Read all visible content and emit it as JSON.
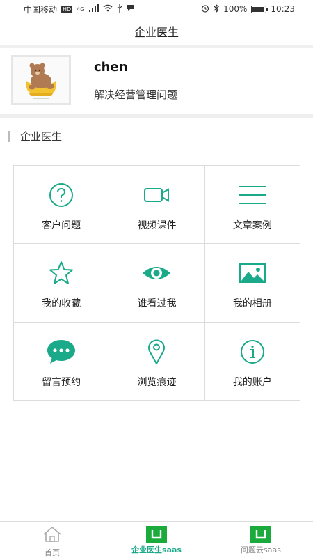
{
  "status_bar": {
    "carrier": "中国移动",
    "hd": "HD",
    "network": "4G",
    "battery": "100%",
    "time": "10:23"
  },
  "header": {
    "title": "企业医生"
  },
  "profile": {
    "name": "chen",
    "subtitle": "解决经营管理问题"
  },
  "section": {
    "title": "企业医生"
  },
  "grid": {
    "items": [
      {
        "label": "客户问题",
        "icon": "question-icon"
      },
      {
        "label": "视频课件",
        "icon": "video-camera-icon"
      },
      {
        "label": "文章案例",
        "icon": "article-lines-icon"
      },
      {
        "label": "我的收藏",
        "icon": "star-icon"
      },
      {
        "label": "谁看过我",
        "icon": "eye-icon"
      },
      {
        "label": "我的相册",
        "icon": "image-icon"
      },
      {
        "label": "留言预约",
        "icon": "chat-bubble-icon"
      },
      {
        "label": "浏览痕迹",
        "icon": "location-pin-icon"
      },
      {
        "label": "我的账户",
        "icon": "info-icon"
      }
    ]
  },
  "tabbar": {
    "tabs": [
      {
        "label": "首页",
        "icon": "home-icon"
      },
      {
        "label": "企业医生saas",
        "icon": "saas-icon"
      },
      {
        "label": "问题云saas",
        "icon": "saas-icon"
      }
    ],
    "active_index": 1
  },
  "colors": {
    "accent": "#1aaa8a",
    "tab_green": "#1aab3c"
  }
}
